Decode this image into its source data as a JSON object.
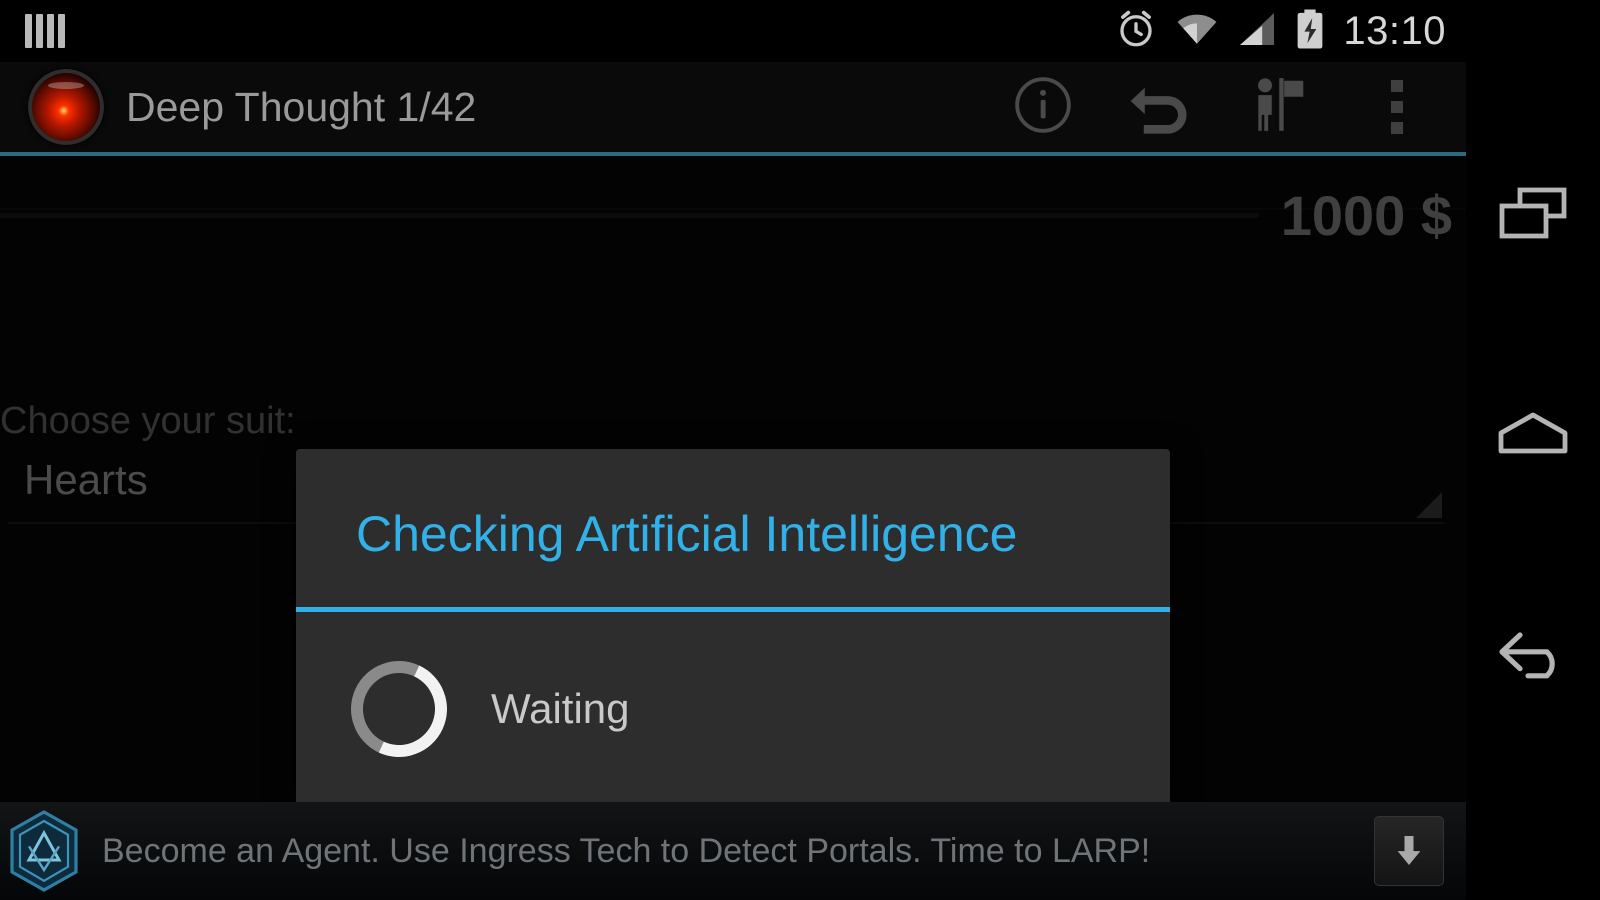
{
  "statusbar": {
    "notification_icon": "four-bars-icon",
    "icons": [
      "alarm-icon",
      "wifi-icon",
      "signal-icon",
      "battery-charging-icon"
    ],
    "time": "13:10"
  },
  "actionbar": {
    "app_icon": "hal-eye-icon",
    "title": "Deep Thought 1/42",
    "actions": [
      {
        "name": "info-button",
        "icon": "info-icon"
      },
      {
        "name": "undo-button",
        "icon": "undo-icon"
      },
      {
        "name": "player-flag-button",
        "icon": "person-flag-icon"
      },
      {
        "name": "overflow-menu-button",
        "icon": "overflow-dots-icon"
      }
    ]
  },
  "content": {
    "money": "1000 $",
    "suit_label": "Choose your suit:",
    "suit_value": "Hearts"
  },
  "dialog": {
    "title": "Checking Artificial Intelligence",
    "status": "Waiting",
    "spinner_icon": "loading-spinner-icon",
    "accent_color": "#32b0e8",
    "background_color": "#2d2d2d"
  },
  "ad": {
    "logo": "ingress-hexagon-icon",
    "text": "Become an Agent. Use Ingress  Tech to Detect Portals. Time to LARP!",
    "cta_icon": "download-arrow-icon"
  },
  "navbar": {
    "buttons": [
      {
        "name": "nav-recents-button",
        "icon": "recents-icon"
      },
      {
        "name": "nav-home-button",
        "icon": "home-icon"
      },
      {
        "name": "nav-back-button",
        "icon": "back-icon"
      }
    ]
  }
}
